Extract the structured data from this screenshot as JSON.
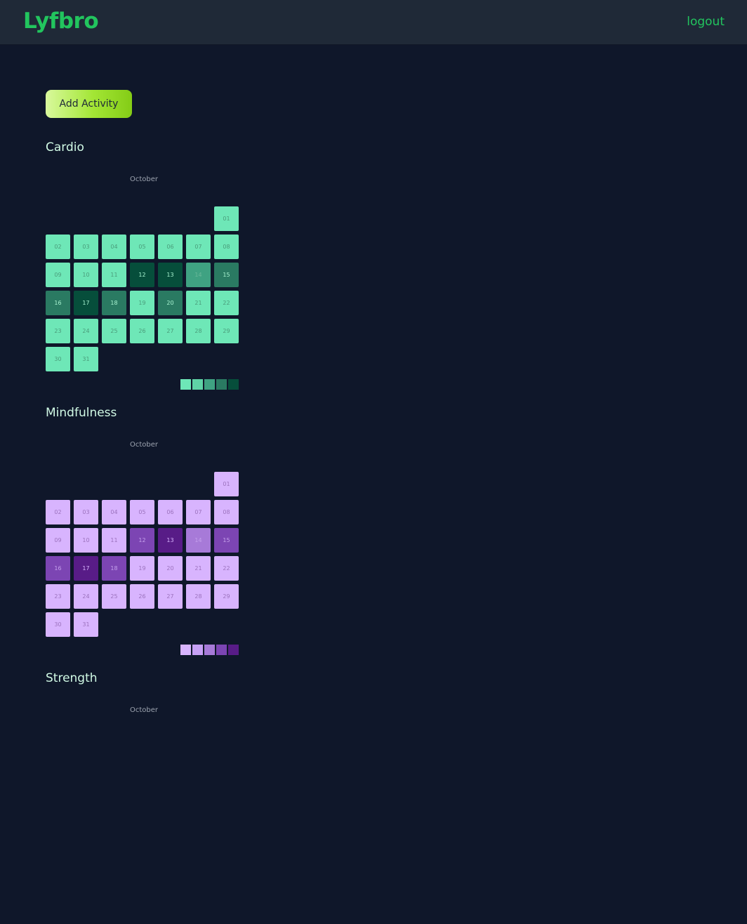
{
  "app": {
    "logo": "Lyfbro",
    "logout_label": "logout"
  },
  "toolbar": {
    "add_activity_label": "Add Activity"
  },
  "sections": [
    {
      "title": "Cardio",
      "month": "October",
      "palette": [
        "#6ee7b7",
        "#5fd3a6",
        "#3fa282",
        "#2a7a62",
        "#064e3b"
      ],
      "text_colors": [
        "#4a9c7a",
        "#4a9c7a",
        "#6bb89a",
        "#a7f3d0",
        "#a7f3d0"
      ],
      "days": [
        {
          "label": "01",
          "level": 0
        },
        {
          "label": "02",
          "level": 0
        },
        {
          "label": "03",
          "level": 0
        },
        {
          "label": "04",
          "level": 0
        },
        {
          "label": "05",
          "level": 0
        },
        {
          "label": "06",
          "level": 0
        },
        {
          "label": "07",
          "level": 0
        },
        {
          "label": "08",
          "level": 0
        },
        {
          "label": "09",
          "level": 0
        },
        {
          "label": "10",
          "level": 0
        },
        {
          "label": "11",
          "level": 0
        },
        {
          "label": "12",
          "level": 4
        },
        {
          "label": "13",
          "level": 4
        },
        {
          "label": "14",
          "level": 2
        },
        {
          "label": "15",
          "level": 3
        },
        {
          "label": "16",
          "level": 3
        },
        {
          "label": "17",
          "level": 4
        },
        {
          "label": "18",
          "level": 3
        },
        {
          "label": "19",
          "level": 0
        },
        {
          "label": "20",
          "level": 3
        },
        {
          "label": "21",
          "level": 0
        },
        {
          "label": "22",
          "level": 0
        },
        {
          "label": "23",
          "level": 0
        },
        {
          "label": "24",
          "level": 0
        },
        {
          "label": "25",
          "level": 0
        },
        {
          "label": "26",
          "level": 0
        },
        {
          "label": "27",
          "level": 0
        },
        {
          "label": "28",
          "level": 0
        },
        {
          "label": "29",
          "level": 0
        },
        {
          "label": "30",
          "level": 0
        },
        {
          "label": "31",
          "level": 0
        }
      ]
    },
    {
      "title": "Mindfulness",
      "month": "October",
      "palette": [
        "#d8b4fe",
        "#c7a0f5",
        "#a77ad8",
        "#7c45b3",
        "#581c87"
      ],
      "text_colors": [
        "#9b72bd",
        "#9b72bd",
        "#c5a0ec",
        "#c5a0ec",
        "#d8b4fe"
      ],
      "days": [
        {
          "label": "01",
          "level": 0
        },
        {
          "label": "02",
          "level": 0
        },
        {
          "label": "03",
          "level": 0
        },
        {
          "label": "04",
          "level": 0
        },
        {
          "label": "05",
          "level": 0
        },
        {
          "label": "06",
          "level": 0
        },
        {
          "label": "07",
          "level": 0
        },
        {
          "label": "08",
          "level": 0
        },
        {
          "label": "09",
          "level": 0
        },
        {
          "label": "10",
          "level": 0
        },
        {
          "label": "11",
          "level": 0
        },
        {
          "label": "12",
          "level": 3
        },
        {
          "label": "13",
          "level": 4
        },
        {
          "label": "14",
          "level": 2
        },
        {
          "label": "15",
          "level": 3
        },
        {
          "label": "16",
          "level": 3
        },
        {
          "label": "17",
          "level": 4
        },
        {
          "label": "18",
          "level": 3
        },
        {
          "label": "19",
          "level": 0
        },
        {
          "label": "20",
          "level": 0
        },
        {
          "label": "21",
          "level": 0
        },
        {
          "label": "22",
          "level": 0
        },
        {
          "label": "23",
          "level": 0
        },
        {
          "label": "24",
          "level": 0
        },
        {
          "label": "25",
          "level": 0
        },
        {
          "label": "26",
          "level": 0
        },
        {
          "label": "27",
          "level": 0
        },
        {
          "label": "28",
          "level": 0
        },
        {
          "label": "29",
          "level": 0
        },
        {
          "label": "30",
          "level": 0
        },
        {
          "label": "31",
          "level": 0
        }
      ]
    },
    {
      "title": "Strength",
      "month": "October",
      "palette": [],
      "text_colors": [],
      "days": []
    }
  ]
}
